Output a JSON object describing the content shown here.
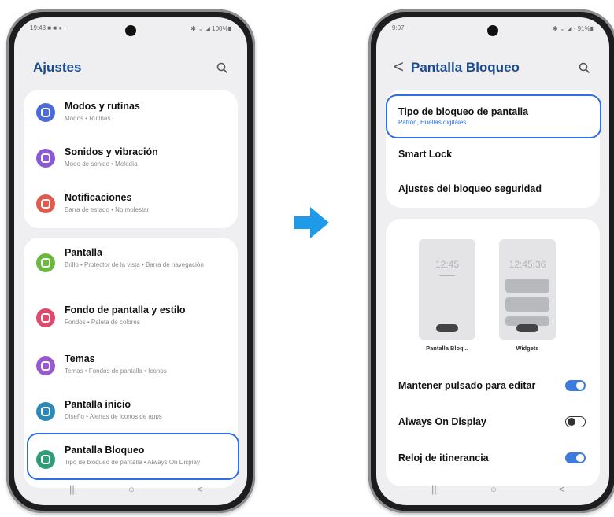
{
  "left_phone": {
    "status": {
      "time": "19:43 ■ ■ ◐ ·",
      "right": "✱ ᯤ ◢ 100%▮"
    },
    "header": {
      "title": "Ajustes"
    },
    "items": [
      {
        "title": "Modos y rutinas",
        "subtitle": "Modos • Rutinas",
        "color": "#4a6bd8"
      },
      {
        "title": "Sonidos y vibración",
        "subtitle": "Modo de sonido • Melodía",
        "color": "#8a5ad6"
      },
      {
        "title": "Notificaciones",
        "subtitle": "Barra de estado • No molestar",
        "color": "#e05a4e"
      },
      {
        "title": "Pantalla",
        "subtitle": "Brillo • Protector de la vista • Barra de navegación",
        "color": "#6ab83c"
      },
      {
        "title": "Fondo de pantalla y estilo",
        "subtitle": "Fondos • Paleta de colores",
        "color": "#e0486c"
      },
      {
        "title": "Temas",
        "subtitle": "Temas • Fondos de pantalla • Iconos",
        "color": "#9a58d0"
      },
      {
        "title": "Pantalla inicio",
        "subtitle": "Diseño • Alertas de iconos de apps",
        "color": "#2a8ab8"
      },
      {
        "title": "Pantalla Bloqueo",
        "subtitle": "Tipo de bloqueo de pantalla • Always On Display",
        "color": "#2f9e78"
      }
    ],
    "nav": {
      "recents": "|||",
      "home": "○",
      "back": "<"
    }
  },
  "right_phone": {
    "status": {
      "time": "9:07",
      "right": "✱ ᯤ ◢ · 91%▮"
    },
    "header": {
      "back": "<",
      "title": "Pantalla Bloqueo"
    },
    "lock_type": {
      "title": "Tipo de bloqueo de pantalla",
      "subtitle": "Patrón, Huellas digitales"
    },
    "smart_lock": "Smart Lock",
    "security": "Ajustes del bloqueo seguridad",
    "previews": [
      {
        "clock": "12:45",
        "caption": "Pantalla Bloq..."
      },
      {
        "clock": "12:45:36",
        "caption": "Widgets"
      }
    ],
    "toggles": [
      {
        "label": "Mantener pulsado para editar",
        "on": true
      },
      {
        "label": "Always On Display",
        "on": false
      },
      {
        "label": "Reloj de itinerancia",
        "on": true
      }
    ],
    "nav": {
      "recents": "|||",
      "home": "○",
      "back": "<"
    }
  },
  "colors": {
    "accent": "#2f6fe0",
    "title": "#1a4b8c",
    "arrow": "#1e9be8"
  }
}
